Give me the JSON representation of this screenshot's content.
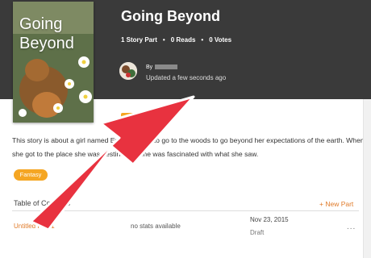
{
  "story": {
    "title": "Going Beyond",
    "cover_title": "Going\nBeyond",
    "stats": {
      "parts": "1 Story Part",
      "reads": "0 Reads",
      "votes": "0 Votes"
    },
    "by_label": "By",
    "updated": "Updated a few seconds ago",
    "description": "This story is about a girl named Evie who had to go to the woods to go beyond her expectations of the earth. When she got to the place she was destined to, she was fascinated with what she saw.",
    "tag": "Fantasy"
  },
  "toc": {
    "label": "Table of Contents",
    "new_part": "+ New Part",
    "parts": [
      {
        "title": "Untitled Part 1",
        "stats": "no stats available",
        "date": "Nov 23, 2015",
        "status": "Draft",
        "menu": "..."
      }
    ]
  },
  "colors": {
    "header_bg": "#3a3a3a",
    "accent_orange": "#f5a623",
    "link_orange": "#e07b2a",
    "arrow_red": "#e8323f"
  }
}
